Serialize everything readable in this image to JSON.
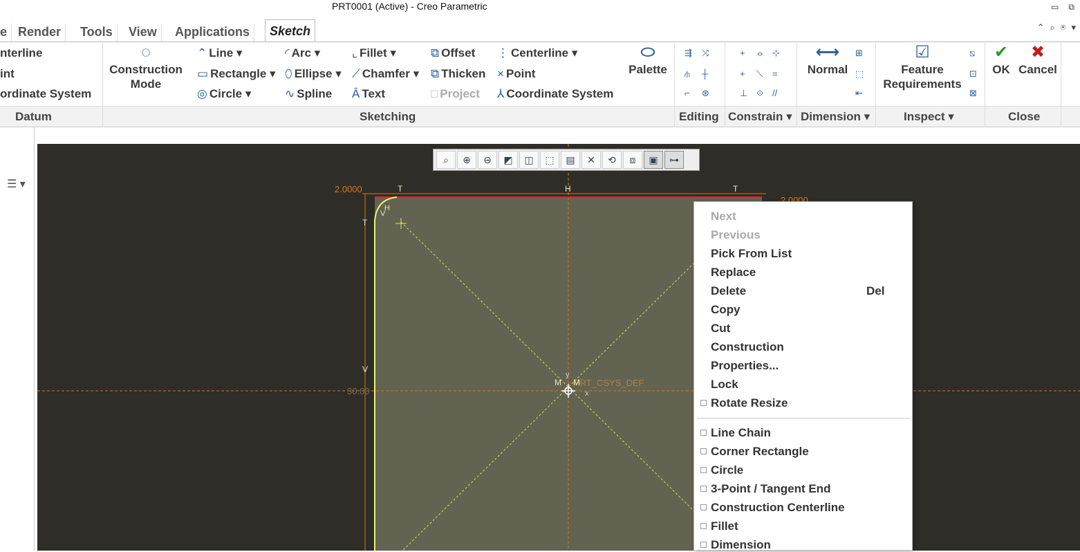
{
  "window": {
    "title": "PRT0001 (Active) - Creo Parametric",
    "controls": [
      "▭",
      "⧉"
    ]
  },
  "tabs": [
    "e",
    "Render",
    "Tools",
    "View",
    "Applications",
    "Sketch"
  ],
  "quick_access": [
    "⌃",
    "⌕",
    "⍟",
    "▾"
  ],
  "datum": {
    "items": [
      "nterline",
      "int",
      "ordinate System"
    ],
    "group": "Datum"
  },
  "construction_mode": {
    "label1": "Construction",
    "label2": "Mode"
  },
  "sketching": {
    "group": "Sketching",
    "line": "Line",
    "rectangle": "Rectangle",
    "circle": "Circle",
    "arc": "Arc",
    "ellipse": "Ellipse",
    "spline": "Spline",
    "fillet": "Fillet",
    "chamfer": "Chamfer",
    "text": "Text",
    "offset": "Offset",
    "thicken": "Thicken",
    "project": "Project",
    "centerline": "Centerline",
    "point": "Point",
    "coordinate_system": "Coordinate System",
    "palette": "Palette"
  },
  "groups": {
    "editing": "Editing",
    "constrain": "Constrain",
    "dimension": "Dimension",
    "inspect": "Inspect",
    "close": "Close"
  },
  "normal": "Normal",
  "feature_req": {
    "line1": "Feature",
    "line2": "Requirements"
  },
  "ok": "OK",
  "cancel": "Cancel",
  "sketch": {
    "dim_left": "2.0000",
    "dim_right": "2.0000",
    "dim_vertical": "30.00",
    "csys": "PRT_CSYS_DEF",
    "constraint_t": "T",
    "constraint_h": "H",
    "constraint_v": "V",
    "constraint_m": "M",
    "axis_y": "y",
    "axis_x": "x"
  },
  "context_menu": {
    "next": "Next",
    "previous": "Previous",
    "pick_from_list": "Pick From List",
    "replace": "Replace",
    "delete": "Delete",
    "delete_shortcut": "Del",
    "copy": "Copy",
    "cut": "Cut",
    "construction": "Construction",
    "properties": "Properties...",
    "lock": "Lock",
    "rotate_resize": "Rotate Resize",
    "line_chain": "Line Chain",
    "corner_rectangle": "Corner Rectangle",
    "circle": "Circle",
    "three_point": "3-Point / Tangent End",
    "construction_centerline": "Construction Centerline",
    "fillet": "Fillet",
    "dimension": "Dimension"
  }
}
